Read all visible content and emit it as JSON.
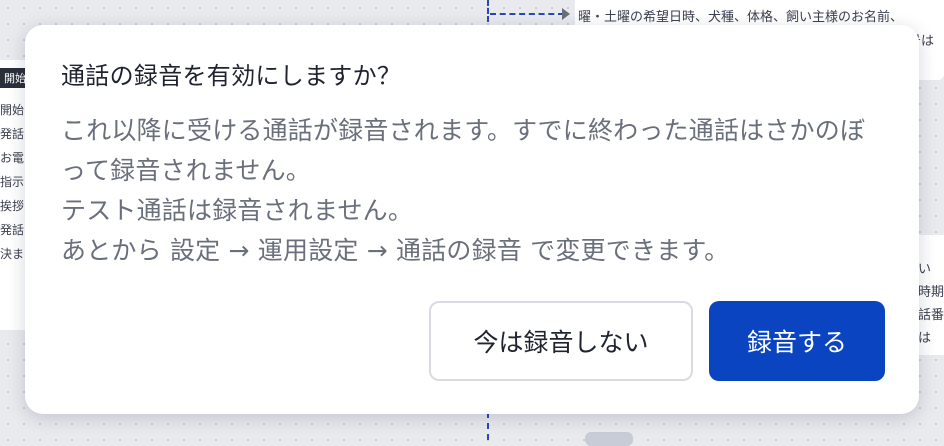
{
  "background": {
    "right_top_text": "曜・土曜の希望日時、犬種、体格、飼い主様のお名前、",
    "right_second_text": "番号は",
    "right_side_lines": [
      "飼い",
      "希時期",
      "ご話番",
      "認は"
    ],
    "left_badge": "開始",
    "left_lines": [
      "開始",
      "発話",
      "お電",
      "指示",
      "挨拶",
      "発話",
      "決ま"
    ]
  },
  "dialog": {
    "title": "通話の録音を有効にしますか？",
    "body_lines": [
      "これ以降に受ける通話が録音されます。すでに終わった通話はさかのぼって録音されません。",
      "テスト通話は録音されません。",
      "あとから 設定 → 運用設定 → 通話の録音 で変更できます。"
    ],
    "secondary_button": "今は録音しない",
    "primary_button": "録音する"
  },
  "colors": {
    "primary": "#0b44c0",
    "title_text": "#1f2330",
    "body_text": "#6a6f7c",
    "connector": "#2849b8"
  }
}
